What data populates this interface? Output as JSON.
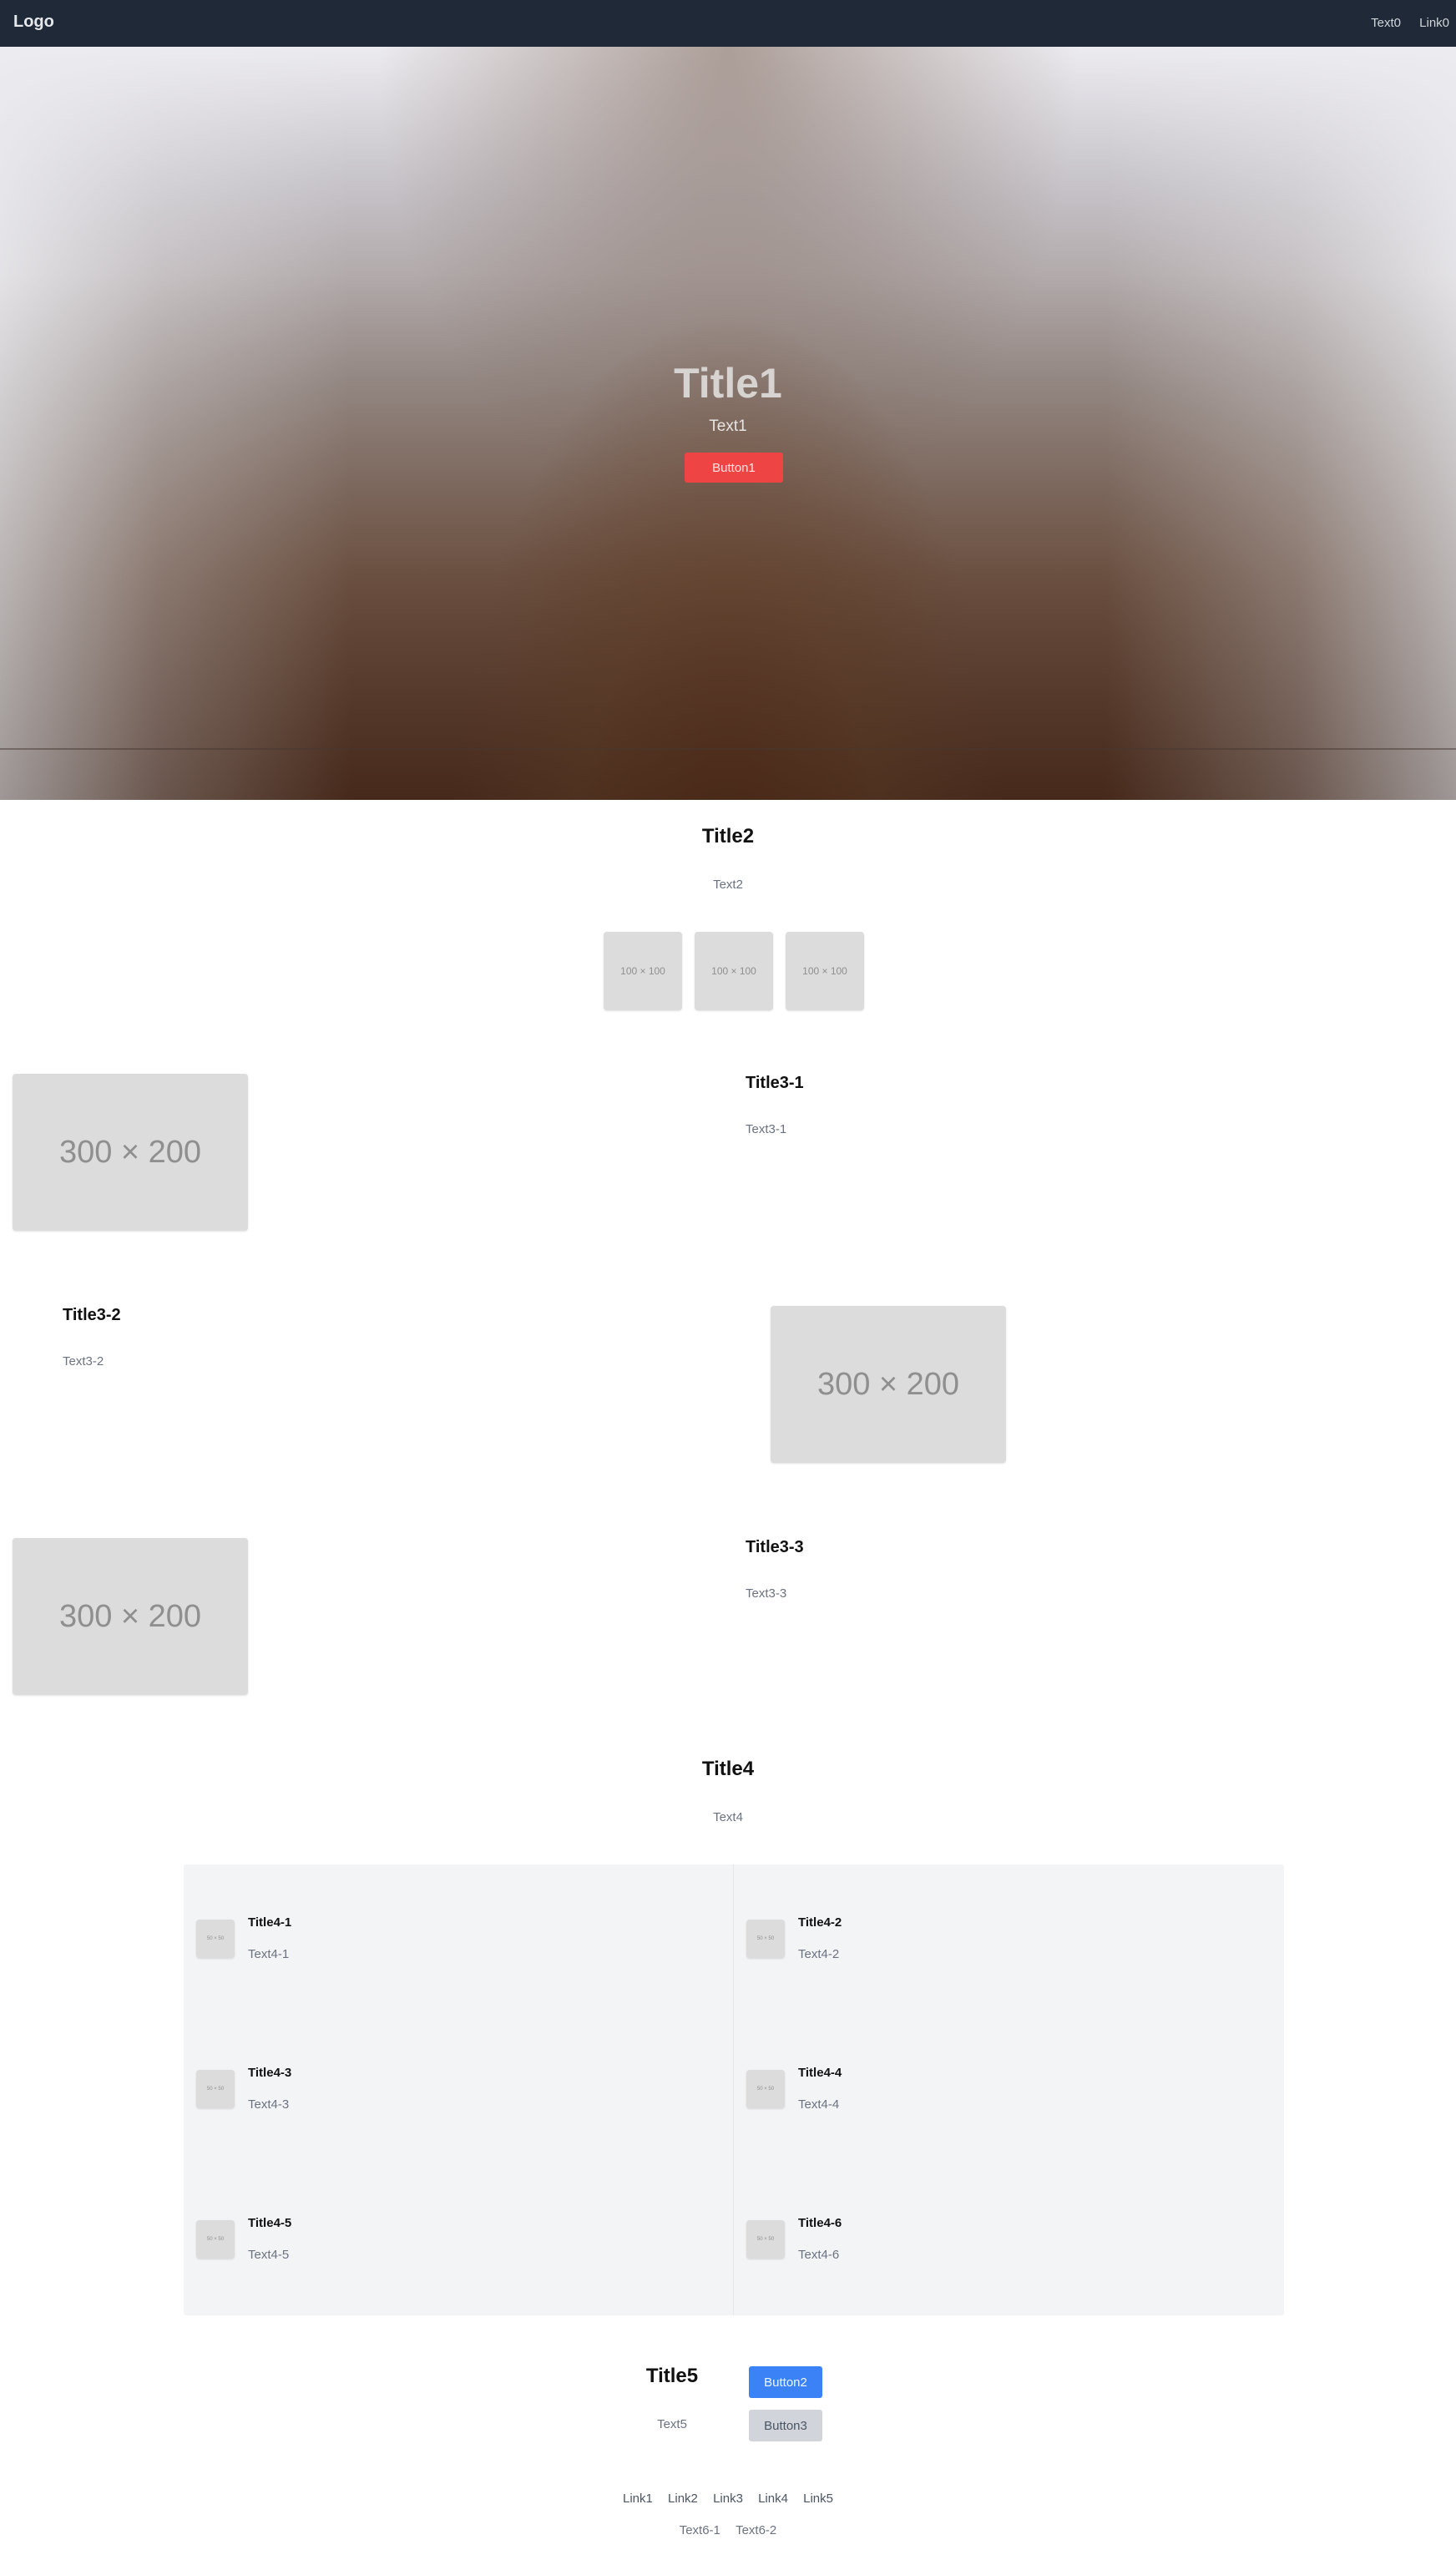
{
  "nav": {
    "logo": "Logo",
    "text": "Text0",
    "link": "Link0"
  },
  "hero": {
    "title": "Title1",
    "text": "Text1",
    "button": "Button1"
  },
  "section2": {
    "title": "Title2",
    "text": "Text2",
    "images": [
      "100 × 100",
      "100 × 100",
      "100 × 100"
    ]
  },
  "features": [
    {
      "title": "Title3-1",
      "text": "Text3-1",
      "image": "300 × 200"
    },
    {
      "title": "Title3-2",
      "text": "Text3-2",
      "image": "300 × 200"
    },
    {
      "title": "Title3-3",
      "text": "Text3-3",
      "image": "300 × 200"
    }
  ],
  "section4": {
    "title": "Title4",
    "text": "Text4",
    "items": [
      {
        "title": "Title4-1",
        "text": "Text4-1",
        "image": "50 × 50"
      },
      {
        "title": "Title4-2",
        "text": "Text4-2",
        "image": "50 × 50"
      },
      {
        "title": "Title4-3",
        "text": "Text4-3",
        "image": "50 × 50"
      },
      {
        "title": "Title4-4",
        "text": "Text4-4",
        "image": "50 × 50"
      },
      {
        "title": "Title4-5",
        "text": "Text4-5",
        "image": "50 × 50"
      },
      {
        "title": "Title4-6",
        "text": "Text4-6",
        "image": "50 × 50"
      }
    ]
  },
  "section5": {
    "title": "Title5",
    "text": "Text5",
    "button_primary": "Button2",
    "button_secondary": "Button3"
  },
  "footer": {
    "links": [
      "Link1",
      "Link2",
      "Link3",
      "Link4",
      "Link5"
    ],
    "texts": [
      "Text6-1",
      "Text6-2"
    ]
  }
}
